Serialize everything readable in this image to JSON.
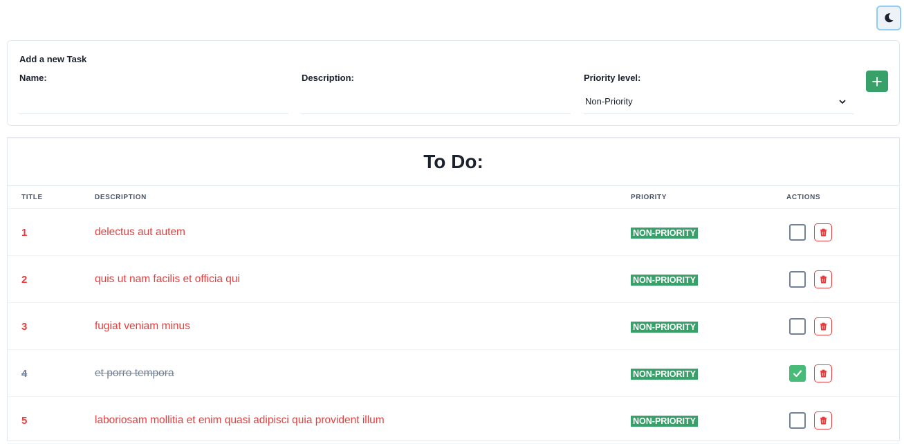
{
  "form": {
    "title": "Add a new Task",
    "name_label": "Name:",
    "name_value": "",
    "description_label": "Description:",
    "description_value": "",
    "priority_label": "Priority level:",
    "priority_selected": "Non-Priority",
    "add_icon": "plus-icon"
  },
  "theme_toggle": {
    "icon": "moon-icon"
  },
  "table": {
    "heading": "To Do:",
    "columns": {
      "title": "TITLE",
      "description": "DESCRIPTION",
      "priority": "PRIORITY",
      "actions": "ACTIONS"
    },
    "rows": [
      {
        "title": "1",
        "description": "delectus aut autem",
        "priority": "NON-PRIORITY",
        "done": false
      },
      {
        "title": "2",
        "description": "quis ut nam facilis et officia qui",
        "priority": "NON-PRIORITY",
        "done": false
      },
      {
        "title": "3",
        "description": "fugiat veniam minus",
        "priority": "NON-PRIORITY",
        "done": false
      },
      {
        "title": "4",
        "description": "et porro tempora",
        "priority": "NON-PRIORITY",
        "done": true
      },
      {
        "title": "5",
        "description": "laboriosam mollitia et enim quasi adipisci quia provident illum",
        "priority": "NON-PRIORITY",
        "done": false
      }
    ]
  },
  "colors": {
    "accent_green": "#38a169",
    "checked_green": "#48bb78",
    "danger_red": "#e53e3e",
    "muted_gray": "#718096"
  }
}
